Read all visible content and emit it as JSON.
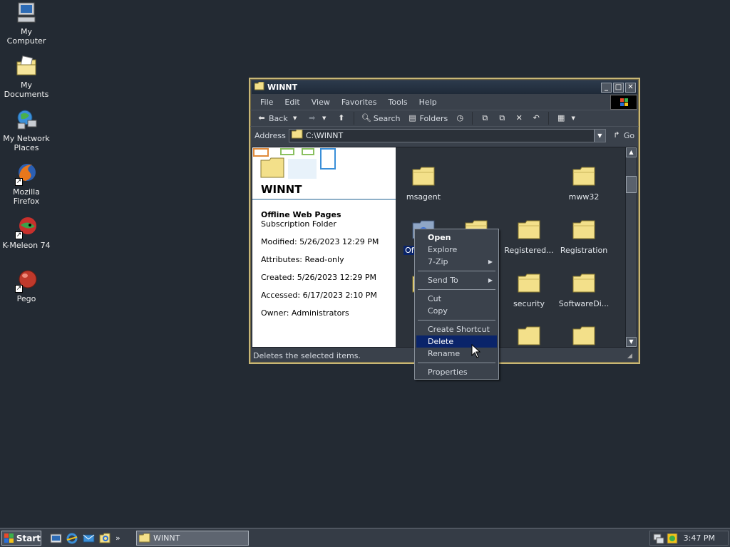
{
  "desktop": {
    "icons": [
      {
        "label": "My Computer"
      },
      {
        "label": "My Documents"
      },
      {
        "label": "My Network Places"
      },
      {
        "label": "Mozilla Firefox"
      },
      {
        "label": "K-Meleon 74"
      },
      {
        "label": "Pego"
      }
    ]
  },
  "window": {
    "title": "WINNT",
    "menu": [
      "File",
      "Edit",
      "View",
      "Favorites",
      "Tools",
      "Help"
    ],
    "toolbar": {
      "back": "Back",
      "search": "Search",
      "folders": "Folders"
    },
    "address": {
      "label": "Address",
      "value": "C:\\WINNT",
      "go": "Go"
    },
    "details": {
      "folder_title": "WINNT",
      "item_name": "Offline Web Pages",
      "item_type": "Subscription Folder",
      "modified": "Modified: 5/26/2023 12:29 PM",
      "attributes": "Attributes: Read-only",
      "created": "Created: 5/26/2023 12:29 PM",
      "accessed": "Accessed: 6/17/2023 2:10 PM",
      "owner": "Owner: Administrators"
    },
    "folders": [
      "msagent",
      "mww32",
      "Offli... P...",
      "",
      "Registered...",
      "Registration",
      "r...",
      "security",
      "SoftwareDi..."
    ],
    "status": "Deletes the selected items."
  },
  "context_menu": {
    "items": [
      "Open",
      "Explore",
      "7-Zip",
      "Send To",
      "Cut",
      "Copy",
      "Create Shortcut",
      "Delete",
      "Rename",
      "Properties"
    ]
  },
  "taskbar": {
    "start": "Start",
    "task": "WINNT",
    "clock": "3:47 PM"
  },
  "colors": {
    "accent_selection": "#0a246a",
    "window_border": "#c9b776",
    "desktop": "#232a33"
  }
}
